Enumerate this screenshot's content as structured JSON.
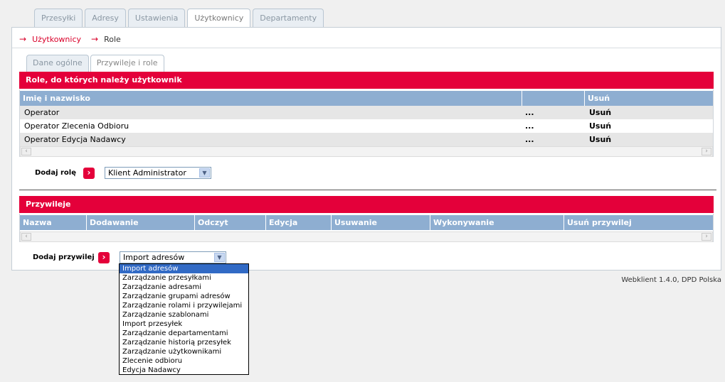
{
  "top_tabs": [
    "Przesyłki",
    "Adresy",
    "Ustawienia",
    "Użytkownicy",
    "Departamenty"
  ],
  "breadcrumb": {
    "link": "Użytkownicy",
    "current": "Role"
  },
  "sub_tabs": [
    "Dane ogólne",
    "Przywileje i role"
  ],
  "roles": {
    "title": "Role, do których należy użytkownik",
    "columns": [
      "Imię i nazwisko",
      "",
      "Usuń"
    ],
    "rows": [
      {
        "name": "Operator",
        "more": "...",
        "delete": "Usuń"
      },
      {
        "name": "Operator Zlecenia Odbioru",
        "more": "...",
        "delete": "Usuń"
      },
      {
        "name": "Operator Edycja Nadawcy",
        "more": "...",
        "delete": "Usuń"
      }
    ],
    "add_label": "Dodaj rolę",
    "select_value": "Klient Administrator"
  },
  "privileges": {
    "title": "Przywileje",
    "columns": [
      "Nazwa",
      "Dodawanie",
      "Odczyt",
      "Edycja",
      "Usuwanie",
      "Wykonywanie",
      "Usuń przywilej"
    ],
    "add_label": "Dodaj przywilej",
    "select_value": "Import adresów",
    "options": [
      "Import adresów",
      "Zarządzanie przesyłkami",
      "Zarządzanie adresami",
      "Zarządzanie grupami adresów",
      "Zarządzanie rolami i przywilejami",
      "Zarządzanie szablonami",
      "Import przesyłek",
      "Zarządzanie departamentami",
      "Zarządzanie historią przesyłek",
      "Zarządzanie użytkownikami",
      "Zlecenie odbioru",
      "Edycja Nadawcy"
    ]
  },
  "footer": "Webklient 1.4.0, DPD Polska",
  "icons": {
    "breadcrumb_arrow": "arrow-right-icon",
    "go": "chevron-right-icon",
    "dropdown": "chevron-down-icon"
  },
  "colors": {
    "accent": "#e4003a",
    "header_blue": "#8eaed1",
    "selected": "#316ac5"
  }
}
